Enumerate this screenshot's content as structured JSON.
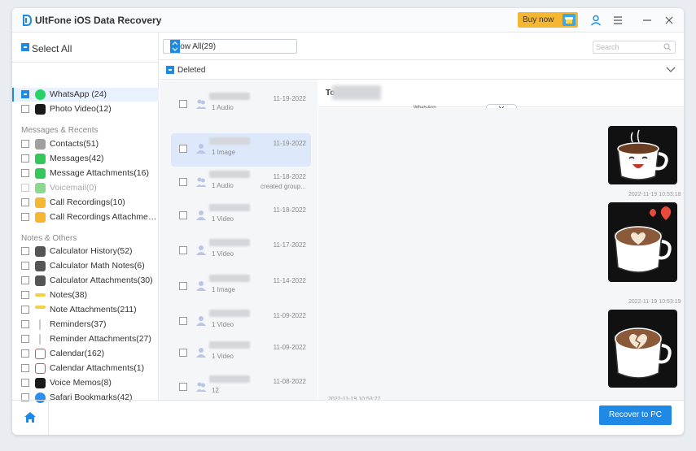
{
  "app": {
    "title": "UltFone iOS Data Recovery",
    "buy_label": "Buy now"
  },
  "sidebar": {
    "select_all": "Select All",
    "top_items": [
      {
        "label": "WhatsApp (24)",
        "icon": "whatsapp-icon",
        "color": "#25d366"
      },
      {
        "label": "Photo Video(12)",
        "icon": "photo-video-icon",
        "color": "#1a1a1a"
      }
    ],
    "groups": [
      {
        "title": "Messages & Recents",
        "items": [
          {
            "label": "Contacts(51)",
            "icon": "contacts-icon",
            "color": "#a0a0a0"
          },
          {
            "label": "Messages(42)",
            "icon": "messages-icon",
            "color": "#34c759"
          },
          {
            "label": "Message Attachments(16)",
            "icon": "message-attachments-icon",
            "color": "#34c759"
          },
          {
            "label": "Voicemail(0)",
            "icon": "voicemail-icon",
            "color": "#8bd98f"
          },
          {
            "label": "Call Recordings(10)",
            "icon": "call-recordings-icon",
            "color": "#f5b731"
          },
          {
            "label": "Call Recordings Attachments(10)",
            "icon": "call-recordings-attachments-icon",
            "color": "#f5b731"
          }
        ]
      },
      {
        "title": "Notes & Others",
        "items": [
          {
            "label": "Calculator History(52)",
            "icon": "calculator-icon",
            "color": "#555555"
          },
          {
            "label": "Calculator Math Notes(6)",
            "icon": "calculator-icon",
            "color": "#555555"
          },
          {
            "label": "Calculator Attachments(30)",
            "icon": "calculator-icon",
            "color": "#555555"
          },
          {
            "label": "Notes(38)",
            "icon": "notes-icon",
            "color": "#f5d142"
          },
          {
            "label": "Note Attachments(211)",
            "icon": "notes-icon",
            "color": "#f5d142"
          },
          {
            "label": "Reminders(37)",
            "icon": "reminders-icon",
            "color": "#cccccc"
          },
          {
            "label": "Reminder Attachments(27)",
            "icon": "reminders-icon",
            "color": "#cccccc"
          },
          {
            "label": "Calendar(162)",
            "icon": "calendar-icon",
            "color": "#e84a3c"
          },
          {
            "label": "Calendar Attachments(1)",
            "icon": "calendar-icon",
            "color": "#e84a3c"
          },
          {
            "label": "Voice Memos(8)",
            "icon": "voice-memos-icon",
            "color": "#1a1a1a"
          },
          {
            "label": "Safari Bookmarks(42)",
            "icon": "safari-icon",
            "color": "#2b8ef0"
          }
        ]
      }
    ]
  },
  "filter": {
    "selected": "Show All(29)",
    "search_placeholder": "Search"
  },
  "deleted_label": "Deleted",
  "conversations": [
    {
      "sub": "1 Audio",
      "date": "11-19-2022",
      "snippet": "",
      "selected": false
    },
    {
      "sub": "1 Image",
      "date": "11-19-2022",
      "snippet": "",
      "selected": true
    },
    {
      "sub": "1 Audio",
      "date": "11-18-2022",
      "snippet": "created group...",
      "selected": false
    },
    {
      "sub": "1 Video",
      "date": "11-18-2022",
      "snippet": "",
      "selected": false
    },
    {
      "sub": "1 Video",
      "date": "11-17-2022",
      "snippet": "",
      "selected": false
    },
    {
      "sub": "1 Image",
      "date": "11-14-2022",
      "snippet": "",
      "selected": false
    },
    {
      "sub": "1 Video",
      "date": "11-09-2022",
      "snippet": "",
      "selected": false
    },
    {
      "sub": "1 Video",
      "date": "11-09-2022",
      "snippet": "",
      "selected": false
    },
    {
      "sub": "12",
      "date": "11-08-2022",
      "snippet": "",
      "selected": false
    }
  ],
  "chat": {
    "to_label": "To",
    "subtitle": "WhatsApp",
    "timestamps": [
      "2022-11-19 10:53:18",
      "2022-11-19 10:53:19",
      "2022-11-19 10:53:27"
    ]
  },
  "footer": {
    "recover_label": "Recover to PC"
  }
}
